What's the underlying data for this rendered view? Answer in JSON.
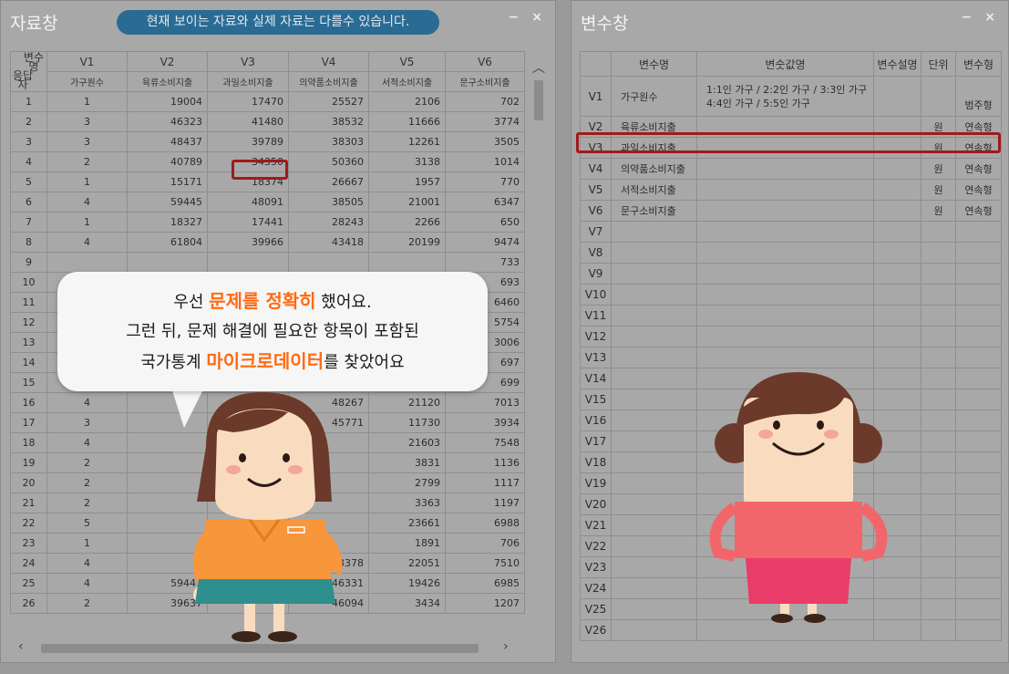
{
  "data_window": {
    "title": "자료창",
    "notice": "현재 보이는 자료와 실제 자료는 다를수 있습니다.",
    "minimize": "−",
    "close": "×",
    "corner_top": "변수\n명",
    "corner_bottom": "응답\n자",
    "columns": [
      "V1",
      "V2",
      "V3",
      "V4",
      "V5",
      "V6"
    ],
    "column_labels": [
      "가구원수",
      "육류소비지출",
      "과일소비지출",
      "의약품소비지출",
      "서적소비지출",
      "문구소비지출"
    ],
    "rows": [
      [
        "1",
        "1",
        "19004",
        "17470",
        "25527",
        "2106",
        "702"
      ],
      [
        "2",
        "3",
        "46323",
        "41480",
        "38532",
        "11666",
        "3774"
      ],
      [
        "3",
        "3",
        "48437",
        "39789",
        "38303",
        "12261",
        "3505"
      ],
      [
        "4",
        "2",
        "40789",
        "34350",
        "50360",
        "3138",
        "1014"
      ],
      [
        "5",
        "1",
        "15171",
        "18374",
        "26667",
        "1957",
        "770"
      ],
      [
        "6",
        "4",
        "59445",
        "48091",
        "38505",
        "21001",
        "6347"
      ],
      [
        "7",
        "1",
        "18327",
        "17441",
        "28243",
        "2266",
        "650"
      ],
      [
        "8",
        "4",
        "61804",
        "39966",
        "43418",
        "20199",
        "9474"
      ],
      [
        "9",
        "",
        "",
        "",
        "",
        "",
        "733"
      ],
      [
        "10",
        "",
        "",
        "",
        "",
        "",
        "693"
      ],
      [
        "11",
        "",
        "",
        "",
        "",
        "",
        "6460"
      ],
      [
        "12",
        "",
        "",
        "",
        "",
        "",
        "5754"
      ],
      [
        "13",
        "",
        "",
        "",
        "",
        "",
        "3006"
      ],
      [
        "14",
        "",
        "",
        "",
        "",
        "",
        "697"
      ],
      [
        "15",
        "1",
        "",
        "",
        "27930",
        "1881",
        "699"
      ],
      [
        "16",
        "4",
        "",
        "",
        "48267",
        "21120",
        "7013"
      ],
      [
        "17",
        "3",
        "",
        "",
        "45771",
        "11730",
        "3934"
      ],
      [
        "18",
        "4",
        "",
        "",
        "",
        "21603",
        "7548"
      ],
      [
        "19",
        "2",
        "",
        "",
        "",
        "3831",
        "1136"
      ],
      [
        "20",
        "2",
        "",
        "",
        "",
        "2799",
        "1117"
      ],
      [
        "21",
        "2",
        "",
        "",
        "",
        "3363",
        "1197"
      ],
      [
        "22",
        "5",
        "",
        "",
        "",
        "23661",
        "6988"
      ],
      [
        "23",
        "1",
        "",
        "",
        "",
        "1891",
        "706"
      ],
      [
        "24",
        "4",
        "",
        "",
        "43378",
        "22051",
        "7510"
      ],
      [
        "25",
        "4",
        "59441",
        "",
        "46331",
        "19426",
        "6985"
      ],
      [
        "26",
        "2",
        "39637",
        "",
        "46094",
        "3434",
        "1207"
      ]
    ]
  },
  "variable_window": {
    "title": "변수창",
    "minimize": "−",
    "close": "×",
    "headers": [
      "",
      "변수명",
      "변숫값명",
      "변수설명",
      "단위",
      "변수형"
    ],
    "rows": [
      {
        "id": "V1",
        "name": "가구원수",
        "values_line1": "1:1인 가구 / 2:2인 가구 / 3:3인 가구",
        "values_line2": "4:4인 가구 / 5:5인 가구",
        "desc": "",
        "unit": "",
        "type": "범주형"
      },
      {
        "id": "V2",
        "name": "육류소비지출",
        "values_line1": "",
        "values_line2": "",
        "desc": "",
        "unit": "원",
        "type": "연속형"
      },
      {
        "id": "V3",
        "name": "과일소비지출",
        "values_line1": "",
        "values_line2": "",
        "desc": "",
        "unit": "원",
        "type": "연속형"
      },
      {
        "id": "V4",
        "name": "의약품소비지출",
        "values_line1": "",
        "values_line2": "",
        "desc": "",
        "unit": "원",
        "type": "연속형"
      },
      {
        "id": "V5",
        "name": "서적소비지출",
        "values_line1": "",
        "values_line2": "",
        "desc": "",
        "unit": "원",
        "type": "연속형"
      },
      {
        "id": "V6",
        "name": "문구소비지출",
        "values_line1": "",
        "values_line2": "",
        "desc": "",
        "unit": "원",
        "type": "연속형"
      }
    ],
    "empty_ids": [
      "V7",
      "V8",
      "V9",
      "V10",
      "V11",
      "V12",
      "V13",
      "V14",
      "V15",
      "V16",
      "V17",
      "V18",
      "V19",
      "V20",
      "V21",
      "V22",
      "V23",
      "V24",
      "V25",
      "V26"
    ]
  },
  "bubble": {
    "line1_pre": "우선 ",
    "line1_em": "문제를 정확히",
    "line1_post": " 했어요.",
    "line2": "그런 뒤, 문제 해결에 필요한 항목이 포함된",
    "line3_pre": "국가통계 ",
    "line3_em": "마이크로데이터",
    "line3_post": "를 찾았어요"
  },
  "colors": {
    "highlight": "#a01a1a",
    "emphasis": "#ff6a13",
    "notice_bg": "#2a6b93"
  }
}
